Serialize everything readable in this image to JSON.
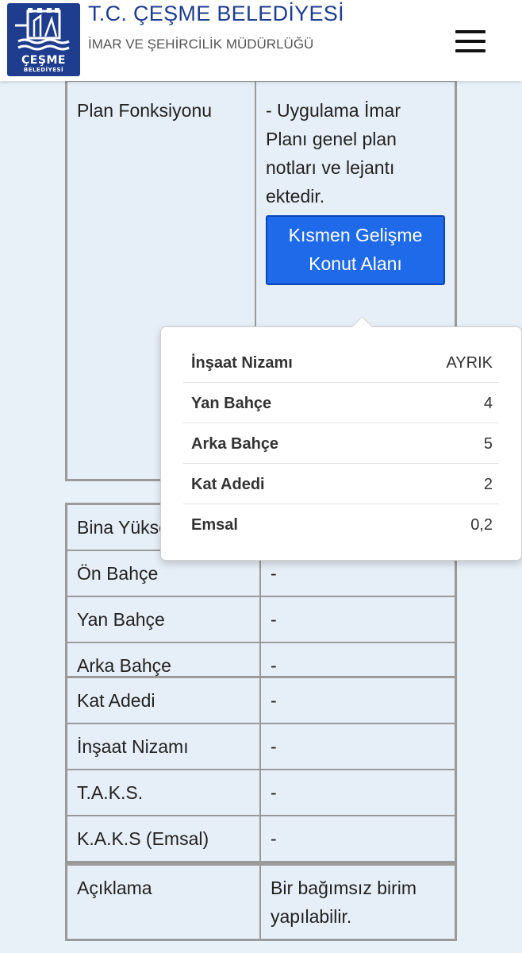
{
  "header": {
    "title": "T.C. ÇEŞME BELEDİYESİ",
    "subtitle": "İMAR VE ŞEHİRCİLİK MÜDÜRLÜĞÜ",
    "logo_text": "ÇEŞME",
    "logo_subtext": "BELEDİYESİ"
  },
  "plan": {
    "label": "Plan Fonksiyonu",
    "note": "- Uygulama İmar Planı genel plan notları ve lejantı ektedir.",
    "button_label": "Kısmen Gelişme Konut Alanı"
  },
  "popover": {
    "rows": [
      {
        "key": "İnşaat Nizamı",
        "value": "AYRIK"
      },
      {
        "key": "Yan Bahçe",
        "value": "4"
      },
      {
        "key": "Arka Bahçe",
        "value": "5"
      },
      {
        "key": "Kat Adedi",
        "value": "2"
      },
      {
        "key": "Emsal",
        "value": "0,2"
      }
    ]
  },
  "table2": {
    "rows": [
      {
        "label": "Bina Yüksekliği",
        "value": "-"
      },
      {
        "label": "Ön Bahçe",
        "value": "-"
      },
      {
        "label": "Yan Bahçe",
        "value": "-"
      },
      {
        "label": "Arka Bahçe",
        "value": "-"
      }
    ]
  },
  "table3": {
    "rows": [
      {
        "label": "Kat Adedi",
        "value": "-"
      },
      {
        "label": "İnşaat Nizamı",
        "value": "-"
      },
      {
        "label": "T.A.K.S.",
        "value": "-"
      },
      {
        "label": "K.A.K.S (Emsal)",
        "value": "-"
      }
    ]
  },
  "table4": {
    "label": "Açıklama",
    "value": "Bir bağımsız birim yapılabilir."
  },
  "colors": {
    "brand": "#1e3d8f",
    "button": "#1f6ae8",
    "background": "#e8f0f8"
  }
}
